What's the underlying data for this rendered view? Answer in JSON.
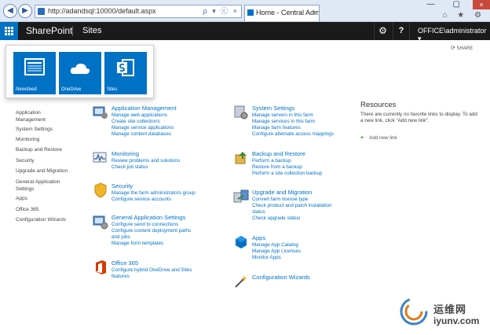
{
  "browser": {
    "address": "http://adandsql:10000/default.aspx",
    "tab_title": "Home - Central Administra...",
    "tab_close": "×",
    "address_icons": "ρ ▾ ⓒ ×",
    "window_controls": "— ▢",
    "close": "×",
    "tools": "⌂ ★ ⚙"
  },
  "suitebar": {
    "title": "SharePoint",
    "sites": "Sites",
    "help": "?",
    "user": "OFFICE\\administrator",
    "share": "SHARE"
  },
  "launcher": {
    "tiles": [
      {
        "label": "Newsfeed"
      },
      {
        "label": "OneDrive"
      },
      {
        "label": "Sites"
      }
    ]
  },
  "leftnav": {
    "items": [
      "Application Management",
      "System Settings",
      "Monitoring",
      "Backup and Restore",
      "Security",
      "Upgrade and Migration",
      "General Application Settings",
      "Apps",
      "Office 365",
      "Configuration Wizards"
    ]
  },
  "sections": {
    "app_mgmt": {
      "title": "Application Management",
      "links": [
        "Manage web applications",
        "Create site collections",
        "Manage service applications",
        "Manage content databases"
      ]
    },
    "monitoring": {
      "title": "Monitoring",
      "links": [
        "Review problems and solutions",
        "Check job status"
      ]
    },
    "security": {
      "title": "Security",
      "links": [
        "Manage the farm administrators group",
        "Configure service accounts"
      ]
    },
    "general": {
      "title": "General Application Settings",
      "links": [
        "Configure send to connections",
        "Configure content deployment paths",
        "and jobs",
        "Manage form templates"
      ]
    },
    "office365": {
      "title": "Office 365",
      "links": [
        "Configure hybrid OneDrive and Sites",
        "features"
      ]
    },
    "system": {
      "title": "System Settings",
      "links": [
        "Manage servers in this farm",
        "Manage services in this farm",
        "Manage farm features",
        "Configure alternate access mappings"
      ]
    },
    "backup": {
      "title": "Backup and Restore",
      "links": [
        "Perform a backup",
        "Restore from a backup",
        "Perform a site collection backup"
      ]
    },
    "upgrade": {
      "title": "Upgrade and Migration",
      "links": [
        "Convert farm license type",
        "Check product and patch installation",
        "status",
        "Check upgrade status"
      ]
    },
    "apps": {
      "title": "Apps",
      "links": [
        "Manage App Catalog",
        "Manage App Licenses",
        "Monitor Apps"
      ]
    },
    "config": {
      "title": "Configuration Wizards",
      "links": []
    }
  },
  "resources": {
    "title": "Resources",
    "text": "There are currently no favorite links to display. To add a new link, click \"Add new link\".",
    "add_icon": "+",
    "add": "Add new link"
  },
  "watermark": {
    "cn": "运维网",
    "url": "iyunv.com"
  },
  "colors": {
    "brand": "#0072c6",
    "suitebar": "#1a1a1a",
    "link": "#0072c6"
  }
}
